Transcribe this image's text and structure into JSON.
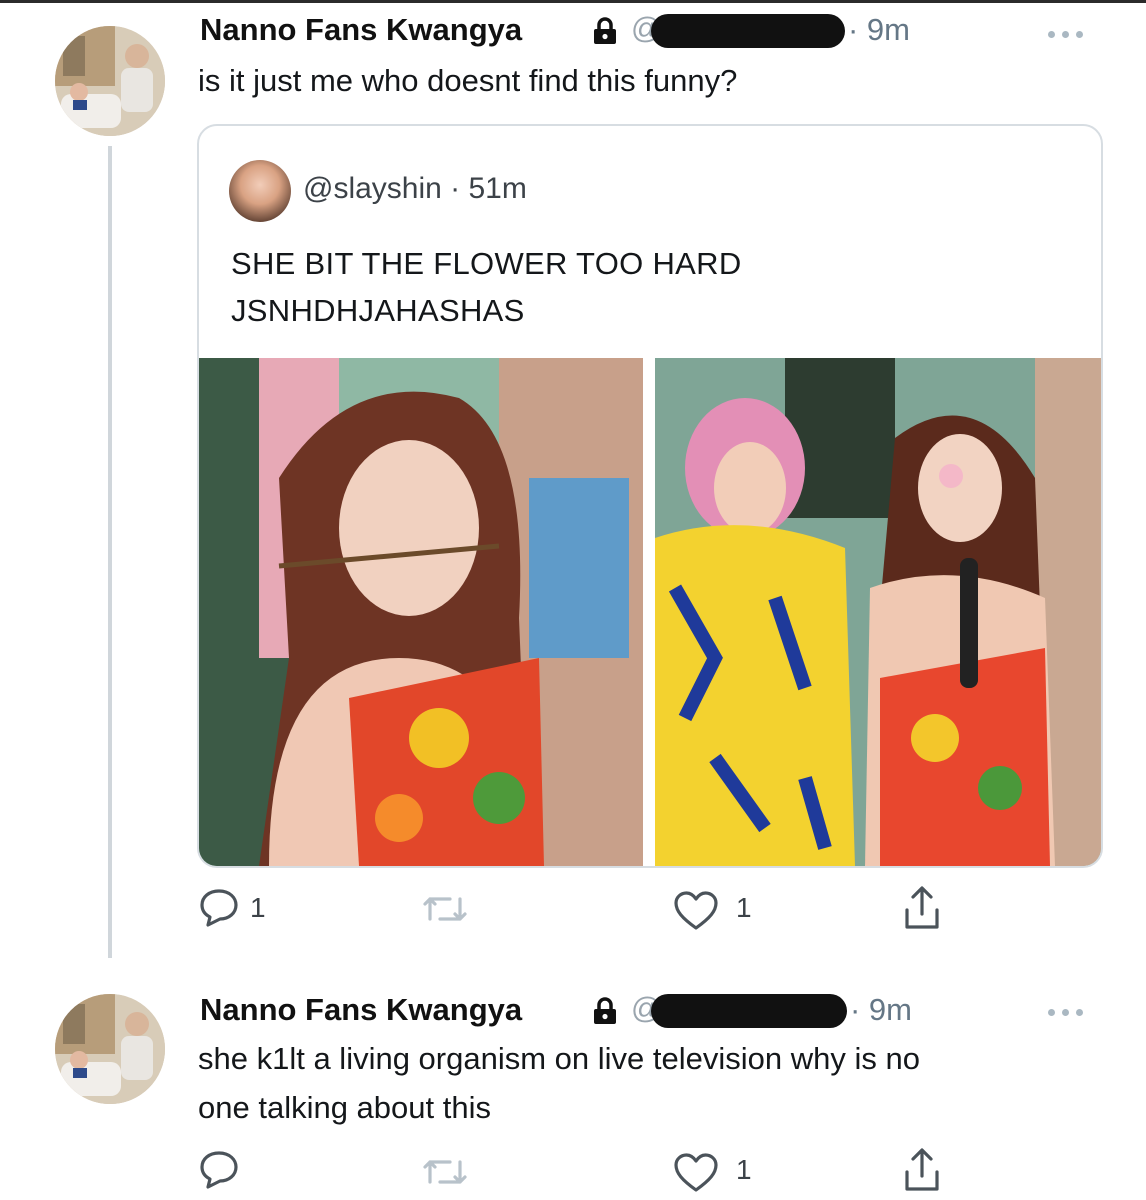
{
  "tweet1": {
    "author": "Nanno Fans Kwangya",
    "handle_prefix": "@",
    "time": "· 9m",
    "text": "is it just me who doesnt find this funny?",
    "quoted": {
      "handle": "@slayshin · 51m",
      "line1": "SHE BIT THE FLOWER TOO HARD",
      "line2": "JSNHDHJAHASHAS"
    },
    "actions": {
      "reply_count": "1",
      "like_count": "1"
    }
  },
  "tweet2": {
    "author": "Nanno Fans Kwangya",
    "handle_prefix": "@",
    "time": "· 9m",
    "text_line1": "she k1lt a living organism on live television why is no",
    "text_line2": "one talking about this",
    "actions": {
      "like_count": "1"
    }
  },
  "icons": {
    "lock": "lock-icon",
    "more": "more-icon",
    "reply": "reply-icon",
    "retweet": "retweet-icon",
    "like": "heart-icon",
    "share": "share-icon"
  },
  "colors": {
    "secondary_text": "#657786",
    "icon_gray": "#aab8c2",
    "border": "#d7dde2"
  }
}
